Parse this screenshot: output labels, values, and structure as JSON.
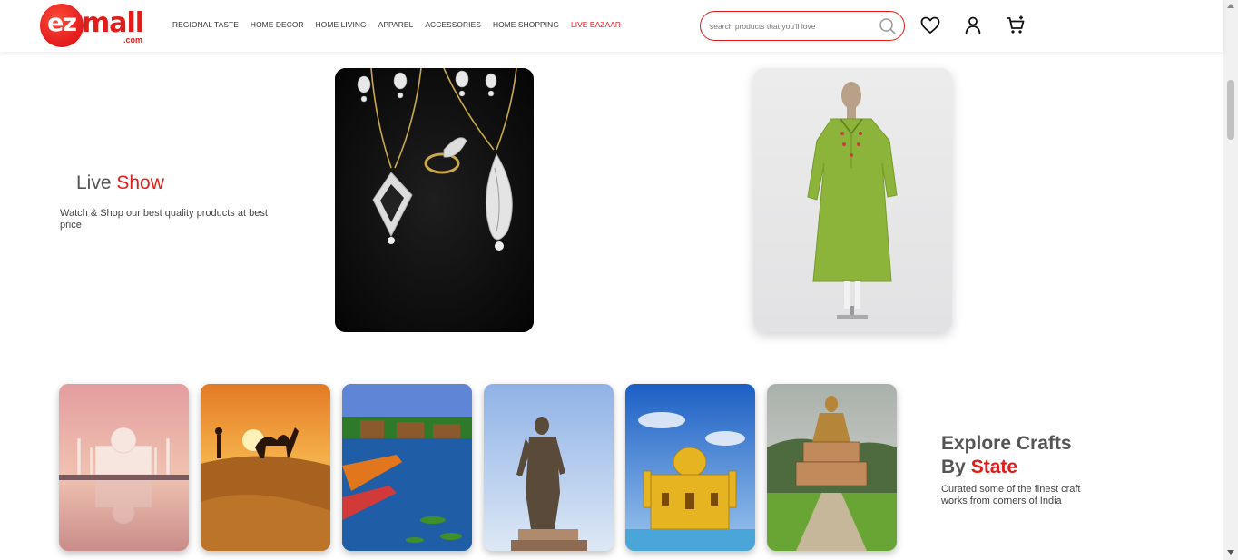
{
  "brand": {
    "logo_ez": "ez",
    "logo_mall": "mall",
    "logo_com": ".com",
    "accent_color": "#e21b1b"
  },
  "nav": {
    "items": [
      {
        "label": "REGIONAL TASTE"
      },
      {
        "label": "HOME DECOR"
      },
      {
        "label": "HOME LIVING"
      },
      {
        "label": "APPAREL"
      },
      {
        "label": "ACCESSORIES"
      },
      {
        "label": "HOME SHOPPING"
      },
      {
        "label": "LIVE BAZAAR"
      }
    ]
  },
  "search": {
    "placeholder": "search products that you'll love"
  },
  "header_icons": [
    "heart-icon",
    "user-icon",
    "cart-icon"
  ],
  "live_show": {
    "title_plain": "Live ",
    "title_accent": "Show",
    "subtitle": "Watch & Shop our best quality products at best price"
  },
  "explore": {
    "title_line1": "Explore Crafts",
    "title_plain": "By ",
    "title_accent": "State",
    "subtitle": "Curated some of the finest craft works from corners of India"
  }
}
